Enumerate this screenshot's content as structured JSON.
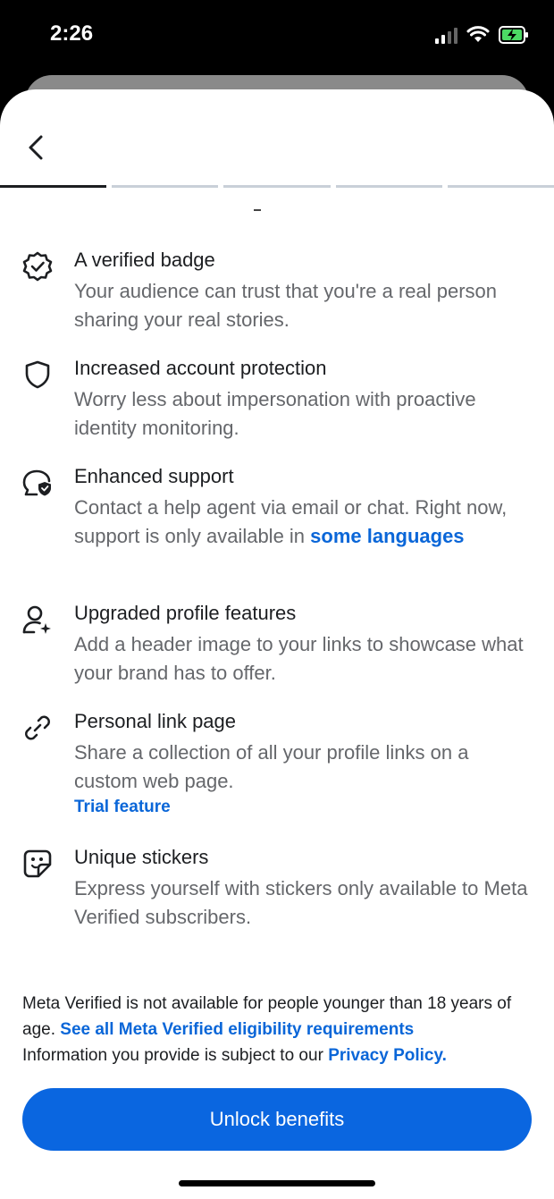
{
  "status_bar": {
    "time": "2:26"
  },
  "colors": {
    "accent": "#0a66e0",
    "link": "#0a66d8",
    "progress_active": "#1c1e21",
    "progress_inactive": "#c9d0d8"
  },
  "progress": {
    "steps": 5,
    "active_step": 1
  },
  "benefits": [
    {
      "icon": "verified-badge-icon",
      "title": "A verified badge",
      "desc": "Your audience can trust that you're a real person sharing your real stories."
    },
    {
      "icon": "shield-icon",
      "title": "Increased account protection",
      "desc": "Worry less about impersonation with proactive identity monitoring."
    },
    {
      "icon": "support-chat-icon",
      "title": "Enhanced support",
      "desc_prefix": "Contact a help agent via email or chat. Right now, support is only available in ",
      "desc_link": "some languages"
    },
    {
      "icon": "profile-sparkle-icon",
      "title": "Upgraded profile features",
      "desc": "Add a header image to your links to showcase what your brand has to offer."
    },
    {
      "icon": "link-icon",
      "title": "Personal link page",
      "desc": "Share a collection of all your profile links on a custom web page.",
      "extra_link": "Trial feature"
    },
    {
      "icon": "sticker-icon",
      "title": "Unique stickers",
      "desc": "Express yourself with stickers only available to Meta Verified subscribers."
    }
  ],
  "footer": {
    "age_text": "Meta Verified is not available for people younger than 18 years of age. ",
    "eligibility_link": "See all Meta Verified eligibility requirements",
    "privacy_text": "Information you provide is subject to our ",
    "privacy_link": "Privacy Policy."
  },
  "cta": {
    "label": "Unlock benefits"
  }
}
